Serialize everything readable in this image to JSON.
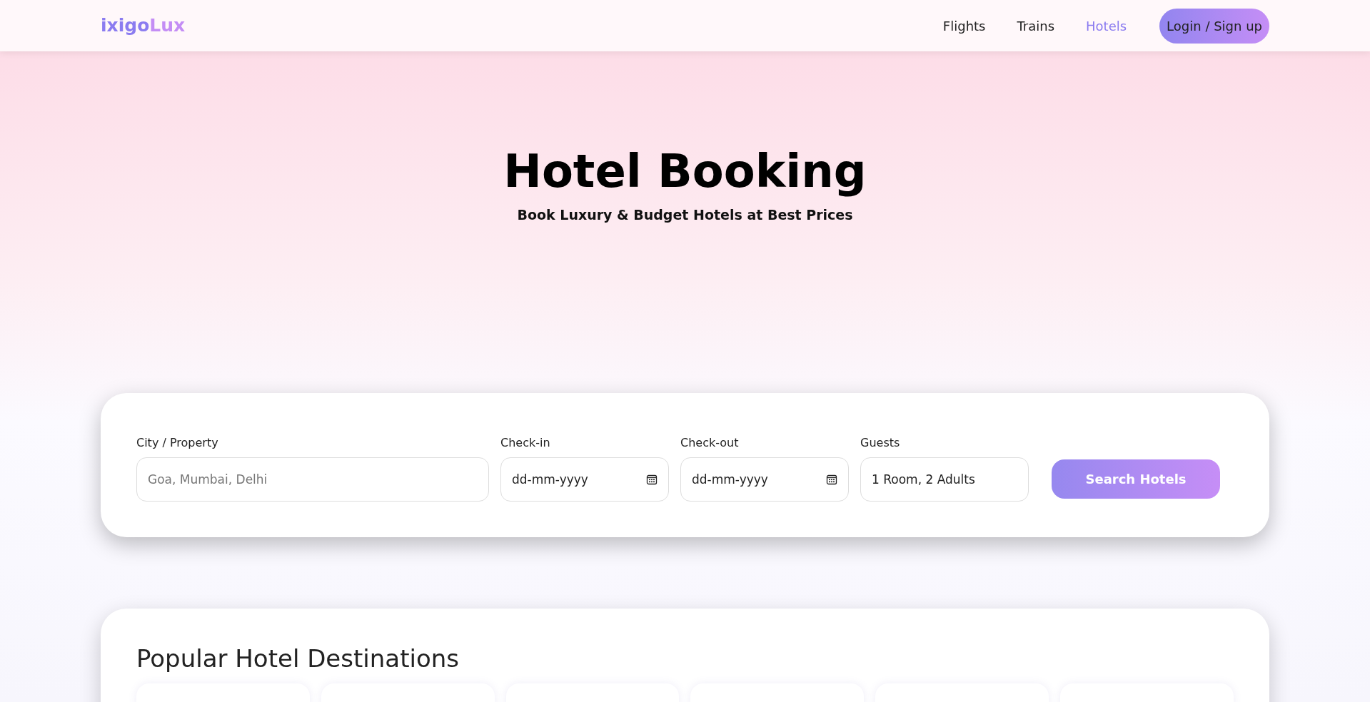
{
  "navbar": {
    "logo": {
      "main": "ixigo",
      "accent": "Lux"
    },
    "links": [
      {
        "label": "Flights",
        "selected": false
      },
      {
        "label": "Trains",
        "selected": false
      },
      {
        "label": "Hotels",
        "selected": true
      }
    ],
    "login_button": "Login / Sign up"
  },
  "hero": {
    "title": "Hotel Booking",
    "subtitle": "Book Luxury & Budget Hotels at Best Prices"
  },
  "search_form": {
    "fields": [
      {
        "kind": "text",
        "label": "City / Property",
        "placeholder": "Goa, Mumbai, Delhi"
      },
      {
        "kind": "date",
        "label": "Check-in",
        "placeholder": "dd-mm-yyyy"
      },
      {
        "kind": "date",
        "label": "Check-out",
        "placeholder": "dd-mm-yyyy"
      },
      {
        "kind": "value",
        "label": "Guests",
        "value": "1 Room, 2 Adults"
      }
    ],
    "button": "Search Hotels"
  },
  "destinations": {
    "heading": "Popular Hotel Destinations"
  }
}
